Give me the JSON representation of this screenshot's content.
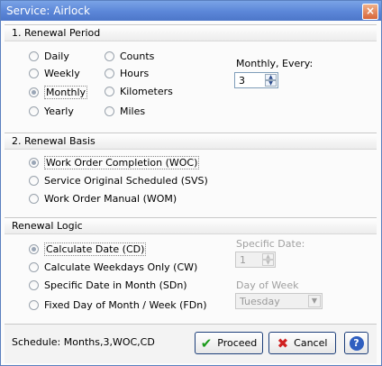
{
  "window": {
    "title": "Service: Airlock"
  },
  "renewal_period": {
    "header": "1. Renewal Period",
    "options_left": [
      "Daily",
      "Weekly",
      "Monthly",
      "Yearly"
    ],
    "options_right": [
      "Counts",
      "Hours",
      "Kilometers",
      "Miles"
    ],
    "selected": "Monthly",
    "every_label": "Monthly, Every:",
    "every_value": "3"
  },
  "renewal_basis": {
    "header": "2. Renewal Basis",
    "options": [
      "Work Order Completion (WOC)",
      "Service Original Scheduled (SVS)",
      "Work Order Manual (WOM)"
    ],
    "selected": "Work Order Completion (WOC)"
  },
  "renewal_logic": {
    "header": "Renewal Logic",
    "options": [
      "Calculate Date (CD)",
      "Calculate Weekdays Only (CW)",
      "Specific Date in Month (SDn)",
      "Fixed Day of Month / Week (FDn)"
    ],
    "selected": "Calculate Date (CD)",
    "specific_date_label": "Specific Date:",
    "specific_date_value": "1",
    "day_of_week_label": "Day of Week",
    "day_of_week_value": "Tuesday"
  },
  "footer": {
    "schedule": "Schedule: Months,3,WOC,CD",
    "proceed_label": "Proceed",
    "cancel_label": "Cancel",
    "help_label": "?"
  },
  "colors": {
    "title_bar": "#5b86d8",
    "accent": "#1d3f7a",
    "proceed_icon": "#1a9a1a",
    "cancel_icon": "#d02020",
    "help_button": "#2f5fc0"
  }
}
